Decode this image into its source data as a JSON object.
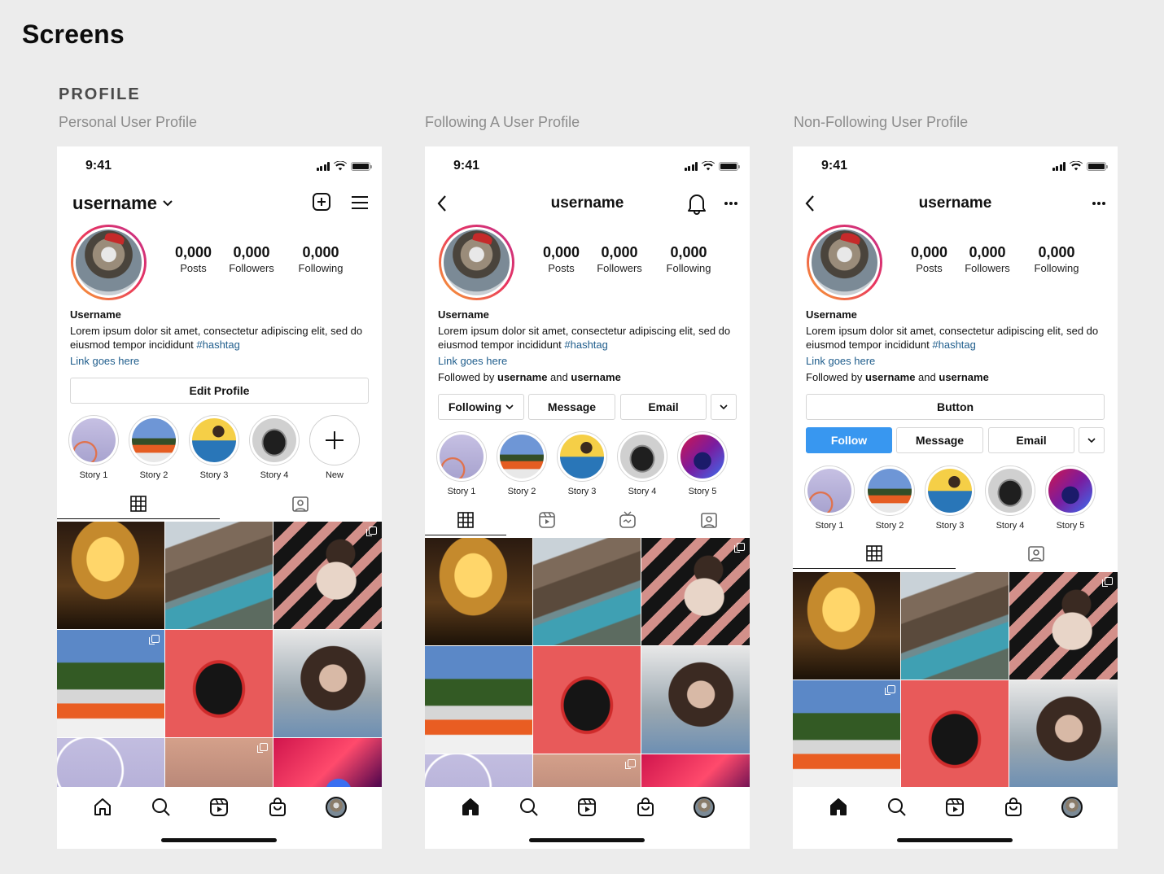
{
  "page_title": "Screens",
  "section_title": "PROFILE",
  "phones": [
    {
      "label": "Personal User Profile",
      "time": "9:41",
      "username": "username",
      "stats": [
        {
          "value": "0,000",
          "label": "Posts"
        },
        {
          "value": "0,000",
          "label": "Followers"
        },
        {
          "value": "0,000",
          "label": "Following"
        }
      ],
      "bio_name": "Username",
      "bio_text": "Lorem ipsum dolor sit amet, consectetur adipiscing elit, sed do eiusmod tempor incididunt",
      "bio_hashtag": "#hashtag",
      "bio_link": "Link goes here",
      "edit_profile": "Edit Profile",
      "stories": [
        "Story 1",
        "Story 2",
        "Story 3",
        "Story 4"
      ],
      "new_story": "New"
    },
    {
      "label": "Following A User Profile",
      "time": "9:41",
      "username": "username",
      "stats": [
        {
          "value": "0,000",
          "label": "Posts"
        },
        {
          "value": "0,000",
          "label": "Followers"
        },
        {
          "value": "0,000",
          "label": "Following"
        }
      ],
      "bio_name": "Username",
      "bio_text": "Lorem ipsum dolor sit amet, consectetur adipiscing elit, sed do eiusmod tempor incididunt",
      "bio_hashtag": "#hashtag",
      "bio_link": "Link goes here",
      "followed_by_prefix": "Followed by",
      "followed_by_user1": "username",
      "followed_by_and": "and",
      "followed_by_user2": "username",
      "following_btn": "Following",
      "message_btn": "Message",
      "email_btn": "Email",
      "stories": [
        "Story 1",
        "Story 2",
        "Story 3",
        "Story 4",
        "Story 5"
      ]
    },
    {
      "label": "Non-Following User Profile",
      "time": "9:41",
      "username": "username",
      "stats": [
        {
          "value": "0,000",
          "label": "Posts"
        },
        {
          "value": "0,000",
          "label": "Followers"
        },
        {
          "value": "0,000",
          "label": "Following"
        }
      ],
      "bio_name": "Username",
      "bio_text": "Lorem ipsum dolor sit amet, consectetur adipiscing elit, sed do eiusmod tempor incididunt",
      "bio_hashtag": "#hashtag",
      "bio_link": "Link goes here",
      "followed_by_prefix": "Followed by",
      "followed_by_user1": "username",
      "followed_by_and": "and",
      "followed_by_user2": "username",
      "generic_btn": "Button",
      "follow_btn": "Follow",
      "message_btn": "Message",
      "email_btn": "Email",
      "stories": [
        "Story 1",
        "Story 2",
        "Story 3",
        "Story 4",
        "Story 5"
      ]
    }
  ],
  "colors": {
    "background": "#ececec",
    "follow_blue": "#3897f0",
    "link_blue": "#1f5d8c",
    "label_gray": "#8c8c8c"
  }
}
